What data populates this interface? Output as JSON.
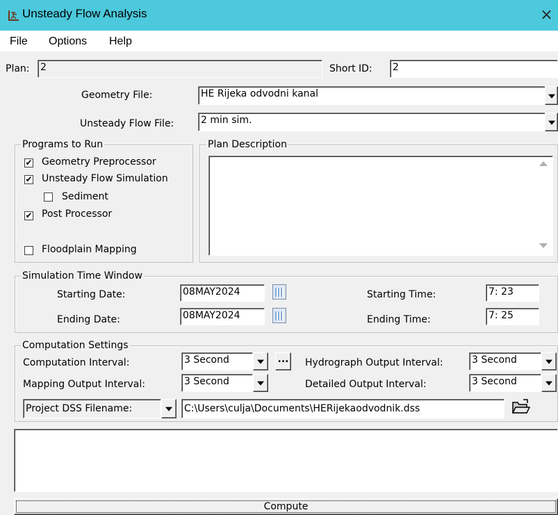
{
  "window": {
    "title": "Unsteady Flow Analysis",
    "close_glyph": "×",
    "title_icon": "hec-ras-figure-icon",
    "title_bar_color": "#4cc9dc"
  },
  "menu": {
    "items": [
      "File",
      "Options",
      "Help"
    ]
  },
  "plan": {
    "label": "Plan:",
    "value": "2",
    "short_id_label": "Short ID:",
    "short_id_value": "2"
  },
  "geometry": {
    "label": "Geometry File:",
    "value": "HE Rijeka odvodni kanal"
  },
  "unsteady_flow": {
    "label": "Unsteady Flow File:",
    "value": "2 min sim."
  },
  "programs": {
    "title": "Programs to Run",
    "items": [
      {
        "label": "Geometry Preprocessor",
        "checked": true,
        "mark": "✔"
      },
      {
        "label": "Unsteady Flow Simulation",
        "checked": true,
        "mark": "✔"
      },
      {
        "label": "Sediment",
        "checked": false,
        "mark": ""
      },
      {
        "label": "Post Processor",
        "checked": true,
        "mark": "✔"
      },
      {
        "label": "Floodplain Mapping",
        "checked": false,
        "mark": ""
      }
    ]
  },
  "plan_description": {
    "title": "Plan Description",
    "value": ""
  },
  "time_window": {
    "title": "Simulation Time Window",
    "starting_date_label": "Starting Date:",
    "starting_date": "08MAY2024",
    "ending_date_label": "Ending Date:",
    "ending_date": "08MAY2024",
    "starting_time_label": "Starting Time:",
    "starting_time": "7: 23",
    "ending_time_label": "Ending Time:",
    "ending_time": "7: 25"
  },
  "computation": {
    "title": "Computation Settings",
    "computation_interval_label": "Computation Interval:",
    "computation_interval": "3 Second",
    "ellipsis_label": "...",
    "hydrograph_label": "Hydrograph Output Interval:",
    "hydrograph_interval": "3 Second",
    "mapping_label": "Mapping Output Interval:",
    "mapping_interval": "3 Second",
    "detailed_label": "Detailed Output Interval:",
    "detailed_interval": "3 Second",
    "dss_selector": "Project DSS Filename:",
    "dss_path": "C:\\Users\\culja\\Documents\\HERijekaodvodnik.dss"
  },
  "log": {
    "value": ""
  },
  "compute_button": "Compute"
}
